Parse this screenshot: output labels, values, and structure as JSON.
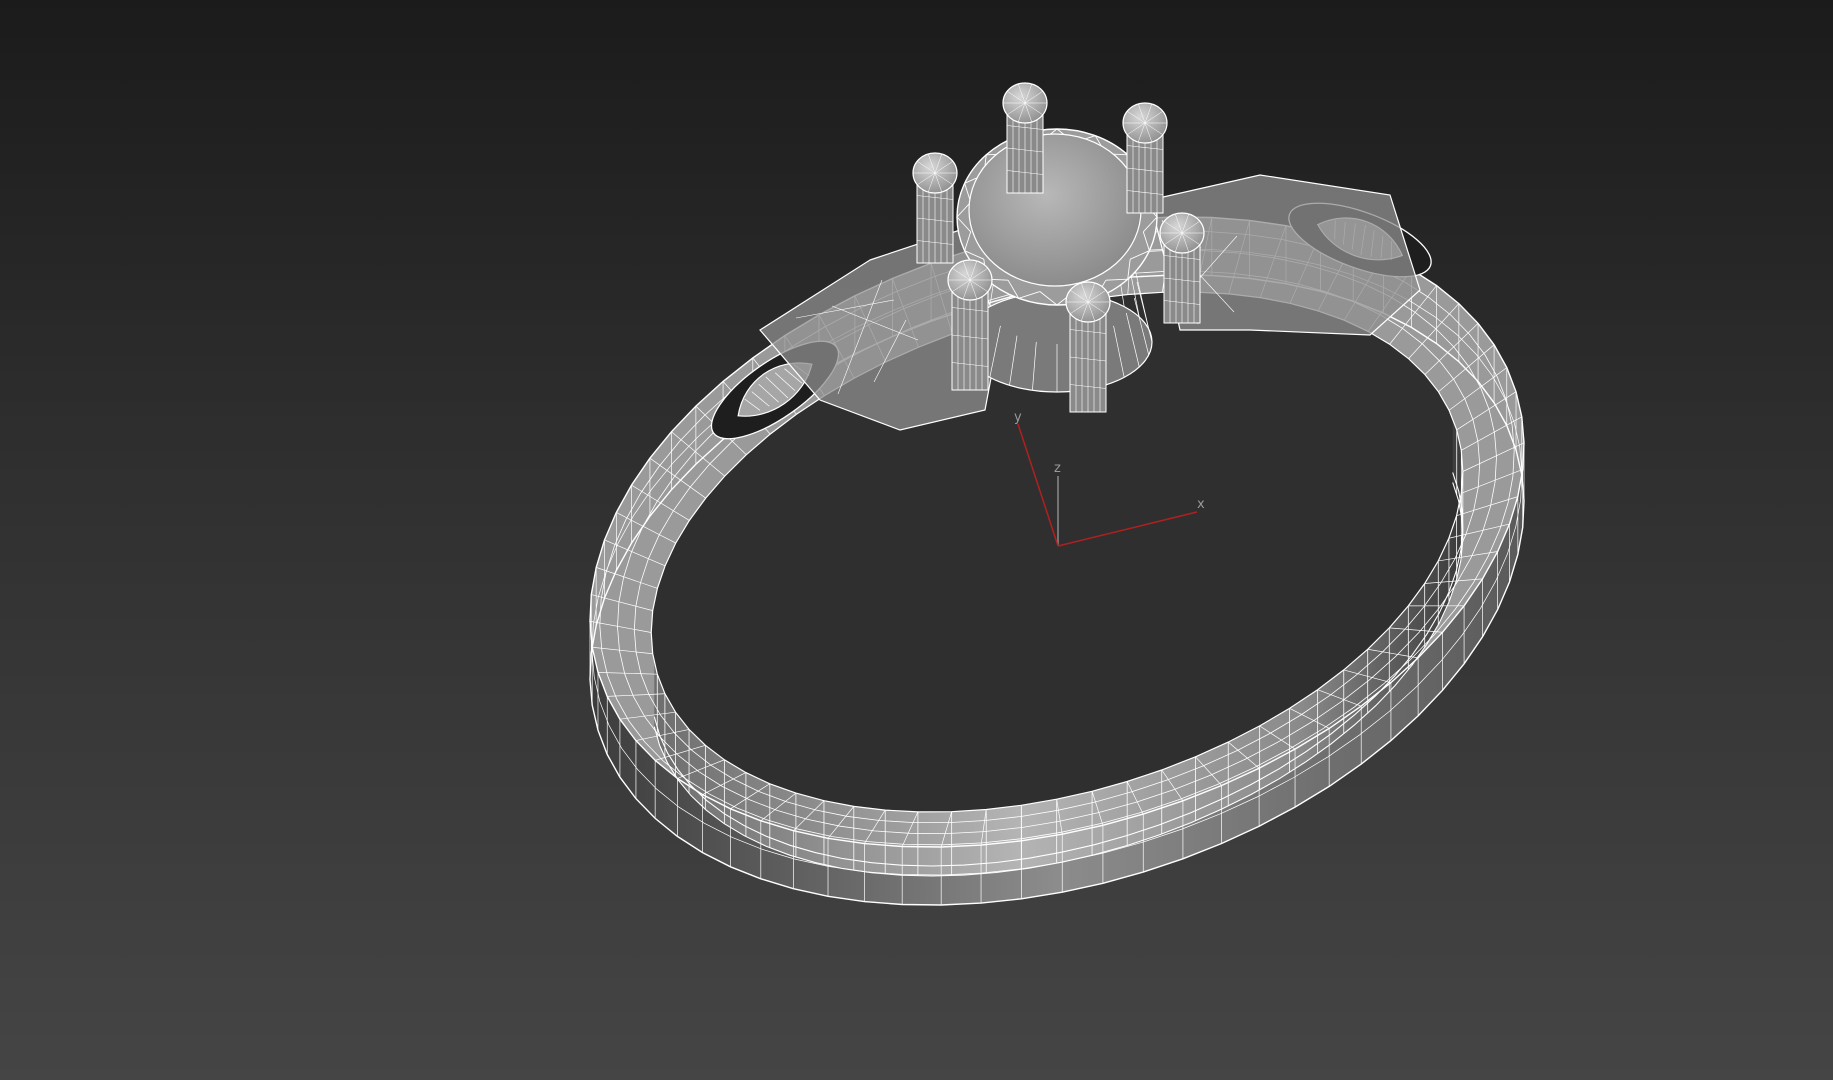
{
  "viewport": {
    "background_top": "#1b1b1b",
    "background_bottom": "#454545",
    "wire_color": "#ffffff"
  },
  "model": {
    "prong_count": 6,
    "band_segment_count": 72
  },
  "gizmo": {
    "x_label": "x",
    "y_label": "y",
    "z_label": "z",
    "x_color": "#b02020",
    "y_color": "#b02020",
    "z_color": "#8a8a8a"
  }
}
